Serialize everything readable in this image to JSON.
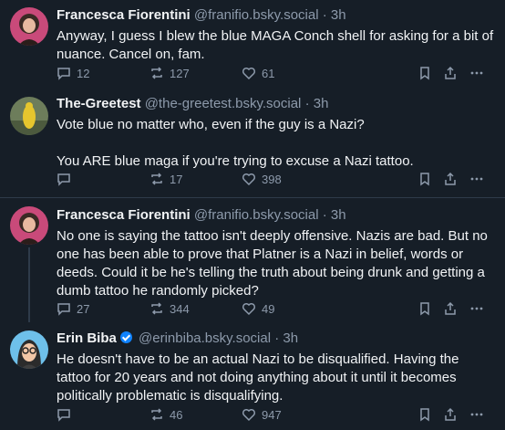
{
  "posts": [
    {
      "author": "Francesca Fiorentini",
      "handle": "@franifio.bsky.social",
      "time": "3h",
      "body": [
        "Anyway, I guess I blew the blue MAGA Conch shell for asking for a bit of nuance. Cancel on, fam."
      ],
      "replies": "12",
      "reposts": "127",
      "likes": "61",
      "avatar": "woman-dark-hair-avatar"
    },
    {
      "author": "The-Greetest",
      "handle": "@the-greetest.bsky.social",
      "time": "3h",
      "body": [
        "Vote blue no matter who, even if the guy is a Nazi?",
        "You ARE blue maga if you're trying to excuse a Nazi tattoo."
      ],
      "replies": "",
      "reposts": "17",
      "likes": "398",
      "avatar": "yellow-figure-avatar"
    },
    {
      "author": "Francesca Fiorentini",
      "handle": "@franifio.bsky.social",
      "time": "3h",
      "body": [
        "No one is saying the tattoo isn't deeply offensive. Nazis are bad. But no one has been able to prove that Platner is a Nazi in belief, words or deeds. Could it be he's telling the truth about being drunk and getting a dumb tattoo he randomly picked?"
      ],
      "replies": "27",
      "reposts": "344",
      "likes": "49",
      "avatar": "woman-dark-hair-avatar"
    },
    {
      "author": "Erin Biba",
      "verified": true,
      "handle": "@erinbiba.bsky.social",
      "time": "3h",
      "body": [
        "He doesn't have to be an actual Nazi to be disqualified. Having the tattoo for 20 years and not doing anything about it until it becomes politically problematic is disqualifying."
      ],
      "replies": "",
      "reposts": "46",
      "likes": "947",
      "avatar": "cartoon-woman-glasses-avatar"
    }
  ],
  "separator": "·",
  "colors": {
    "background": "#161e27",
    "text": "#f1f3f5",
    "muted": "#8d9aab",
    "divider": "#2e3b4a",
    "verified": "#1083fe"
  }
}
